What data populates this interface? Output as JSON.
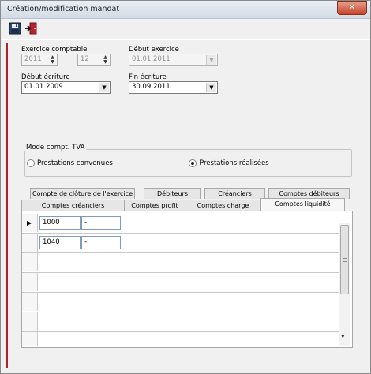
{
  "window": {
    "title": "Création/modification mandat",
    "close_label": "✕"
  },
  "toolbar": {
    "save_icon": "floppy-disk-icon",
    "exit_icon": "exit-door-icon"
  },
  "exercice": {
    "label": "Exercice comptable",
    "year": "2011",
    "month": "12",
    "debut_exercice_label": "Début exercice",
    "debut_exercice_value": "01.01.2011"
  },
  "ecriture": {
    "debut_label": "Début écriture",
    "debut_value": "01.01.2009",
    "fin_label": "Fin écriture",
    "fin_value": "30.09.2011"
  },
  "tva": {
    "group_label": "Mode compt. TVA",
    "option1": "Prestations convenues",
    "option2": "Prestations réalisées",
    "selected": "option2"
  },
  "tabs": {
    "row_back": [
      "Compte de clôture de l'exercice",
      "Débiteurs",
      "Créanciers",
      "Comptes débiteurs"
    ],
    "row_front": [
      "Comptes créanciers",
      "Comptes profit",
      "Comptes charge",
      "Comptes liquidité"
    ],
    "active": "Comptes liquidité"
  },
  "grid": {
    "current_row_marker": "▶",
    "rows": [
      {
        "account": "1000",
        "name": "-"
      },
      {
        "account": "1040",
        "name": "-"
      },
      {
        "account": "",
        "name": ""
      },
      {
        "account": "",
        "name": ""
      },
      {
        "account": "",
        "name": ""
      },
      {
        "account": "",
        "name": ""
      }
    ]
  },
  "colors": {
    "accent_bar": "#b01f2e",
    "close_button": "#c8432b"
  }
}
